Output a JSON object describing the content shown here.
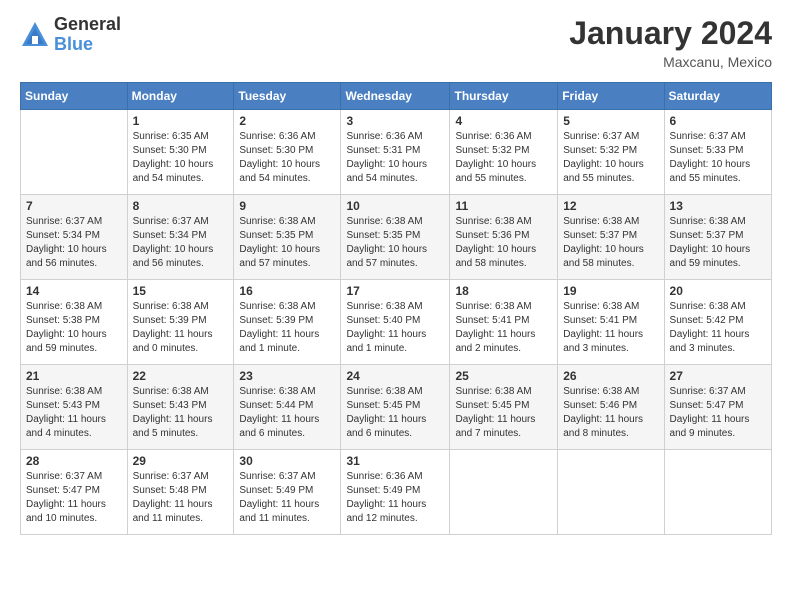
{
  "logo": {
    "general": "General",
    "blue": "Blue"
  },
  "header": {
    "month_year": "January 2024",
    "location": "Maxcanu, Mexico"
  },
  "weekdays": [
    "Sunday",
    "Monday",
    "Tuesday",
    "Wednesday",
    "Thursday",
    "Friday",
    "Saturday"
  ],
  "weeks": [
    [
      {
        "day": "",
        "info": ""
      },
      {
        "day": "1",
        "info": "Sunrise: 6:35 AM\nSunset: 5:30 PM\nDaylight: 10 hours\nand 54 minutes."
      },
      {
        "day": "2",
        "info": "Sunrise: 6:36 AM\nSunset: 5:30 PM\nDaylight: 10 hours\nand 54 minutes."
      },
      {
        "day": "3",
        "info": "Sunrise: 6:36 AM\nSunset: 5:31 PM\nDaylight: 10 hours\nand 54 minutes."
      },
      {
        "day": "4",
        "info": "Sunrise: 6:36 AM\nSunset: 5:32 PM\nDaylight: 10 hours\nand 55 minutes."
      },
      {
        "day": "5",
        "info": "Sunrise: 6:37 AM\nSunset: 5:32 PM\nDaylight: 10 hours\nand 55 minutes."
      },
      {
        "day": "6",
        "info": "Sunrise: 6:37 AM\nSunset: 5:33 PM\nDaylight: 10 hours\nand 55 minutes."
      }
    ],
    [
      {
        "day": "7",
        "info": "Sunrise: 6:37 AM\nSunset: 5:34 PM\nDaylight: 10 hours\nand 56 minutes."
      },
      {
        "day": "8",
        "info": "Sunrise: 6:37 AM\nSunset: 5:34 PM\nDaylight: 10 hours\nand 56 minutes."
      },
      {
        "day": "9",
        "info": "Sunrise: 6:38 AM\nSunset: 5:35 PM\nDaylight: 10 hours\nand 57 minutes."
      },
      {
        "day": "10",
        "info": "Sunrise: 6:38 AM\nSunset: 5:35 PM\nDaylight: 10 hours\nand 57 minutes."
      },
      {
        "day": "11",
        "info": "Sunrise: 6:38 AM\nSunset: 5:36 PM\nDaylight: 10 hours\nand 58 minutes."
      },
      {
        "day": "12",
        "info": "Sunrise: 6:38 AM\nSunset: 5:37 PM\nDaylight: 10 hours\nand 58 minutes."
      },
      {
        "day": "13",
        "info": "Sunrise: 6:38 AM\nSunset: 5:37 PM\nDaylight: 10 hours\nand 59 minutes."
      }
    ],
    [
      {
        "day": "14",
        "info": "Sunrise: 6:38 AM\nSunset: 5:38 PM\nDaylight: 10 hours\nand 59 minutes."
      },
      {
        "day": "15",
        "info": "Sunrise: 6:38 AM\nSunset: 5:39 PM\nDaylight: 11 hours\nand 0 minutes."
      },
      {
        "day": "16",
        "info": "Sunrise: 6:38 AM\nSunset: 5:39 PM\nDaylight: 11 hours\nand 1 minute."
      },
      {
        "day": "17",
        "info": "Sunrise: 6:38 AM\nSunset: 5:40 PM\nDaylight: 11 hours\nand 1 minute."
      },
      {
        "day": "18",
        "info": "Sunrise: 6:38 AM\nSunset: 5:41 PM\nDaylight: 11 hours\nand 2 minutes."
      },
      {
        "day": "19",
        "info": "Sunrise: 6:38 AM\nSunset: 5:41 PM\nDaylight: 11 hours\nand 3 minutes."
      },
      {
        "day": "20",
        "info": "Sunrise: 6:38 AM\nSunset: 5:42 PM\nDaylight: 11 hours\nand 3 minutes."
      }
    ],
    [
      {
        "day": "21",
        "info": "Sunrise: 6:38 AM\nSunset: 5:43 PM\nDaylight: 11 hours\nand 4 minutes."
      },
      {
        "day": "22",
        "info": "Sunrise: 6:38 AM\nSunset: 5:43 PM\nDaylight: 11 hours\nand 5 minutes."
      },
      {
        "day": "23",
        "info": "Sunrise: 6:38 AM\nSunset: 5:44 PM\nDaylight: 11 hours\nand 6 minutes."
      },
      {
        "day": "24",
        "info": "Sunrise: 6:38 AM\nSunset: 5:45 PM\nDaylight: 11 hours\nand 6 minutes."
      },
      {
        "day": "25",
        "info": "Sunrise: 6:38 AM\nSunset: 5:45 PM\nDaylight: 11 hours\nand 7 minutes."
      },
      {
        "day": "26",
        "info": "Sunrise: 6:38 AM\nSunset: 5:46 PM\nDaylight: 11 hours\nand 8 minutes."
      },
      {
        "day": "27",
        "info": "Sunrise: 6:37 AM\nSunset: 5:47 PM\nDaylight: 11 hours\nand 9 minutes."
      }
    ],
    [
      {
        "day": "28",
        "info": "Sunrise: 6:37 AM\nSunset: 5:47 PM\nDaylight: 11 hours\nand 10 minutes."
      },
      {
        "day": "29",
        "info": "Sunrise: 6:37 AM\nSunset: 5:48 PM\nDaylight: 11 hours\nand 11 minutes."
      },
      {
        "day": "30",
        "info": "Sunrise: 6:37 AM\nSunset: 5:49 PM\nDaylight: 11 hours\nand 11 minutes."
      },
      {
        "day": "31",
        "info": "Sunrise: 6:36 AM\nSunset: 5:49 PM\nDaylight: 11 hours\nand 12 minutes."
      },
      {
        "day": "",
        "info": ""
      },
      {
        "day": "",
        "info": ""
      },
      {
        "day": "",
        "info": ""
      }
    ]
  ]
}
